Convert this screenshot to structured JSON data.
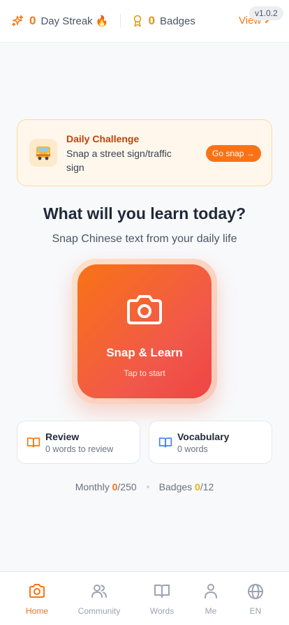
{
  "topbar": {
    "streak_count": "0",
    "streak_label": "Day Streak 🔥",
    "badges_count": "0",
    "badges_label": "Badges",
    "view_label": "View",
    "version": "v1.0.2"
  },
  "challenge": {
    "title": "Daily Challenge",
    "text": "Snap a street sign/traffic sign",
    "button_label": "Go snap →",
    "icon": "bus-emoji 🚌"
  },
  "hero": {
    "headline": "What will you learn today?",
    "subline": "Snap Chinese text from your daily life",
    "snap_title": "Snap & Learn",
    "snap_sub": "Tap to start"
  },
  "cards": {
    "review": {
      "title": "Review",
      "sub": "0 words to review"
    },
    "vocabulary": {
      "title": "Vocabulary",
      "sub": "0 words"
    }
  },
  "stats": {
    "monthly_label": "Monthly",
    "monthly_value": "0",
    "monthly_total": "/250",
    "badges_label": "Badges",
    "badges_value": "0",
    "badges_total": "/12"
  },
  "nav": {
    "items": [
      {
        "label": "Home",
        "icon": "camera-icon",
        "active": true
      },
      {
        "label": "Community",
        "icon": "users-icon",
        "active": false
      },
      {
        "label": "Words",
        "icon": "book-icon",
        "active": false
      },
      {
        "label": "Me",
        "icon": "user-icon",
        "active": false
      },
      {
        "label": "EN",
        "icon": "globe-icon",
        "active": false
      }
    ]
  },
  "colors": {
    "accent": "#f97316",
    "gold": "#eab308",
    "challenge_bg": "#fff7ec",
    "blue_icon": "#3b82f6"
  }
}
